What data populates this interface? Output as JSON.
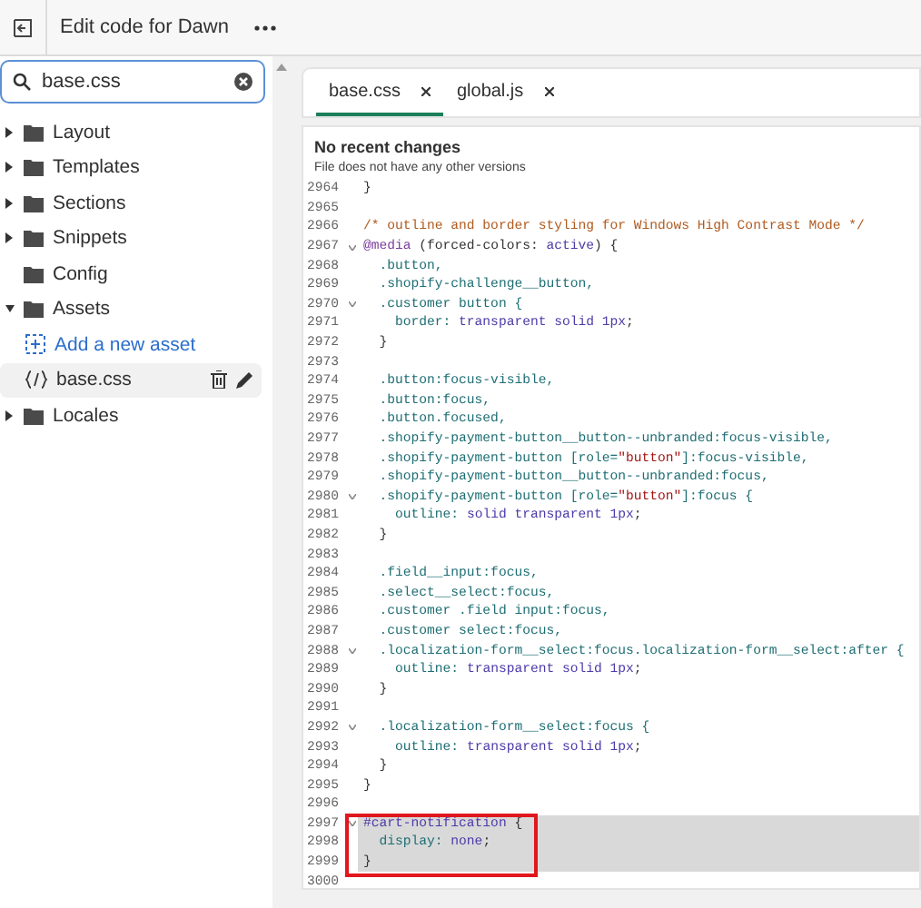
{
  "topbar": {
    "title": "Edit code for Dawn"
  },
  "sidebar": {
    "search": {
      "value": "base.css"
    },
    "tree": [
      {
        "label": "Layout",
        "kind": "folder",
        "expanded": false
      },
      {
        "label": "Templates",
        "kind": "folder",
        "expanded": false
      },
      {
        "label": "Sections",
        "kind": "folder",
        "expanded": false
      },
      {
        "label": "Snippets",
        "kind": "folder",
        "expanded": false
      },
      {
        "label": "Config",
        "kind": "folder-empty"
      },
      {
        "label": "Assets",
        "kind": "folder",
        "expanded": true,
        "children": [
          {
            "label": "Add a new asset",
            "kind": "action"
          },
          {
            "label": "base.css",
            "kind": "file",
            "selected": true
          }
        ]
      },
      {
        "label": "Locales",
        "kind": "folder",
        "expanded": false
      }
    ]
  },
  "editor": {
    "tabs": [
      {
        "label": "base.css",
        "selected": true
      },
      {
        "label": "global.js",
        "selected": false
      }
    ],
    "history": {
      "title": "No recent changes",
      "subtitle": "File does not have any other versions"
    },
    "lines": [
      {
        "number": "2964",
        "highlighted": false,
        "tokens": [
          {
            "kind": "plain",
            "text": "}"
          }
        ]
      },
      {
        "number": "2965"
      },
      {
        "number": "2966",
        "highlighted": false,
        "tokens": [
          {
            "kind": "comment",
            "text": "/* outline and border styling for Windows High Contrast Mode */"
          }
        ]
      },
      {
        "number": "2967",
        "highlighted": false,
        "fold": true,
        "tokens": [
          {
            "kind": "keyword",
            "text": "@media"
          },
          {
            "kind": "plain",
            "text": " (forced-colors: "
          },
          {
            "kind": "value",
            "text": "active"
          },
          {
            "kind": "plain",
            "text": ") {"
          }
        ]
      },
      {
        "number": "2968",
        "highlighted": false,
        "tokens": [
          {
            "kind": "selector",
            "text": "  .button,"
          }
        ]
      },
      {
        "number": "2969",
        "highlighted": false,
        "tokens": [
          {
            "kind": "selector",
            "text": "  .shopify-challenge__button,"
          }
        ]
      },
      {
        "number": "2970",
        "highlighted": false,
        "fold": true,
        "tokens": [
          {
            "kind": "selector",
            "text": "  .customer button {"
          }
        ]
      },
      {
        "number": "2971",
        "highlighted": false,
        "tokens": [
          {
            "kind": "property",
            "text": "    border: "
          },
          {
            "kind": "value",
            "text": "transparent solid 1px"
          },
          {
            "kind": "plain",
            "text": ";"
          }
        ]
      },
      {
        "number": "2972",
        "highlighted": false,
        "tokens": [
          {
            "kind": "plain",
            "text": "  }"
          }
        ]
      },
      {
        "number": "2973"
      },
      {
        "number": "2974",
        "highlighted": false,
        "tokens": [
          {
            "kind": "selector",
            "text": "  .button:focus-visible,"
          }
        ]
      },
      {
        "number": "2975",
        "highlighted": false,
        "tokens": [
          {
            "kind": "selector",
            "text": "  .button:focus,"
          }
        ]
      },
      {
        "number": "2976",
        "highlighted": false,
        "tokens": [
          {
            "kind": "selector",
            "text": "  .button.focused,"
          }
        ]
      },
      {
        "number": "2977",
        "highlighted": false,
        "tokens": [
          {
            "kind": "selector",
            "text": "  .shopify-payment-button__button--unbranded:focus-visible,"
          }
        ]
      },
      {
        "number": "2978",
        "highlighted": false,
        "tokens": [
          {
            "kind": "selector",
            "text": "  .shopify-payment-button [role="
          },
          {
            "kind": "string",
            "text": "\"button\""
          },
          {
            "kind": "selector",
            "text": "]:focus-visible,"
          }
        ]
      },
      {
        "number": "2979",
        "highlighted": false,
        "tokens": [
          {
            "kind": "selector",
            "text": "  .shopify-payment-button__button--unbranded:focus,"
          }
        ]
      },
      {
        "number": "2980",
        "highlighted": false,
        "fold": true,
        "tokens": [
          {
            "kind": "selector",
            "text": "  .shopify-payment-button [role="
          },
          {
            "kind": "string",
            "text": "\"button\""
          },
          {
            "kind": "selector",
            "text": "]:focus {"
          }
        ]
      },
      {
        "number": "2981",
        "highlighted": false,
        "tokens": [
          {
            "kind": "property",
            "text": "    outline: "
          },
          {
            "kind": "value",
            "text": "solid transparent 1px"
          },
          {
            "kind": "plain",
            "text": ";"
          }
        ]
      },
      {
        "number": "2982",
        "highlighted": false,
        "tokens": [
          {
            "kind": "plain",
            "text": "  }"
          }
        ]
      },
      {
        "number": "2983"
      },
      {
        "number": "2984",
        "highlighted": false,
        "tokens": [
          {
            "kind": "selector",
            "text": "  .field__input:focus,"
          }
        ]
      },
      {
        "number": "2985",
        "highlighted": false,
        "tokens": [
          {
            "kind": "selector",
            "text": "  .select__select:focus,"
          }
        ]
      },
      {
        "number": "2986",
        "highlighted": false,
        "tokens": [
          {
            "kind": "selector",
            "text": "  .customer .field input:focus,"
          }
        ]
      },
      {
        "number": "2987",
        "highlighted": false,
        "tokens": [
          {
            "kind": "selector",
            "text": "  .customer select:focus,"
          }
        ]
      },
      {
        "number": "2988",
        "highlighted": false,
        "fold": true,
        "tokens": [
          {
            "kind": "selector",
            "text": "  .localization-form__select:focus.localization-form__select:after {"
          }
        ]
      },
      {
        "number": "2989",
        "highlighted": false,
        "tokens": [
          {
            "kind": "property",
            "text": "    outline: "
          },
          {
            "kind": "value",
            "text": "transparent solid 1px"
          },
          {
            "kind": "plain",
            "text": ";"
          }
        ]
      },
      {
        "number": "2990",
        "highlighted": false,
        "tokens": [
          {
            "kind": "plain",
            "text": "  }"
          }
        ]
      },
      {
        "number": "2991"
      },
      {
        "number": "2992",
        "highlighted": false,
        "fold": true,
        "tokens": [
          {
            "kind": "selector",
            "text": "  .localization-form__select:focus {"
          }
        ]
      },
      {
        "number": "2993",
        "highlighted": false,
        "tokens": [
          {
            "kind": "property",
            "text": "    outline: "
          },
          {
            "kind": "value",
            "text": "transparent solid 1px"
          },
          {
            "kind": "plain",
            "text": ";"
          }
        ]
      },
      {
        "number": "2994",
        "highlighted": false,
        "tokens": [
          {
            "kind": "plain",
            "text": "  }"
          }
        ]
      },
      {
        "number": "2995",
        "highlighted": false,
        "tokens": [
          {
            "kind": "plain",
            "text": "}"
          }
        ]
      },
      {
        "number": "2996"
      },
      {
        "number": "2997",
        "fold": true,
        "highlighted": true,
        "boxed": true,
        "tokens": [
          {
            "kind": "id",
            "text": "#cart-notification"
          },
          {
            "kind": "plain",
            "text": " {"
          }
        ]
      },
      {
        "number": "2998",
        "highlighted": true,
        "boxed": true,
        "tokens": [
          {
            "kind": "property",
            "text": "  display: "
          },
          {
            "kind": "value",
            "text": "none"
          },
          {
            "kind": "plain",
            "text": ";"
          }
        ]
      },
      {
        "number": "2999",
        "highlighted": true,
        "boxed": true,
        "tokens": [
          {
            "kind": "plain",
            "text": "}"
          }
        ]
      },
      {
        "number": "3000"
      }
    ]
  }
}
